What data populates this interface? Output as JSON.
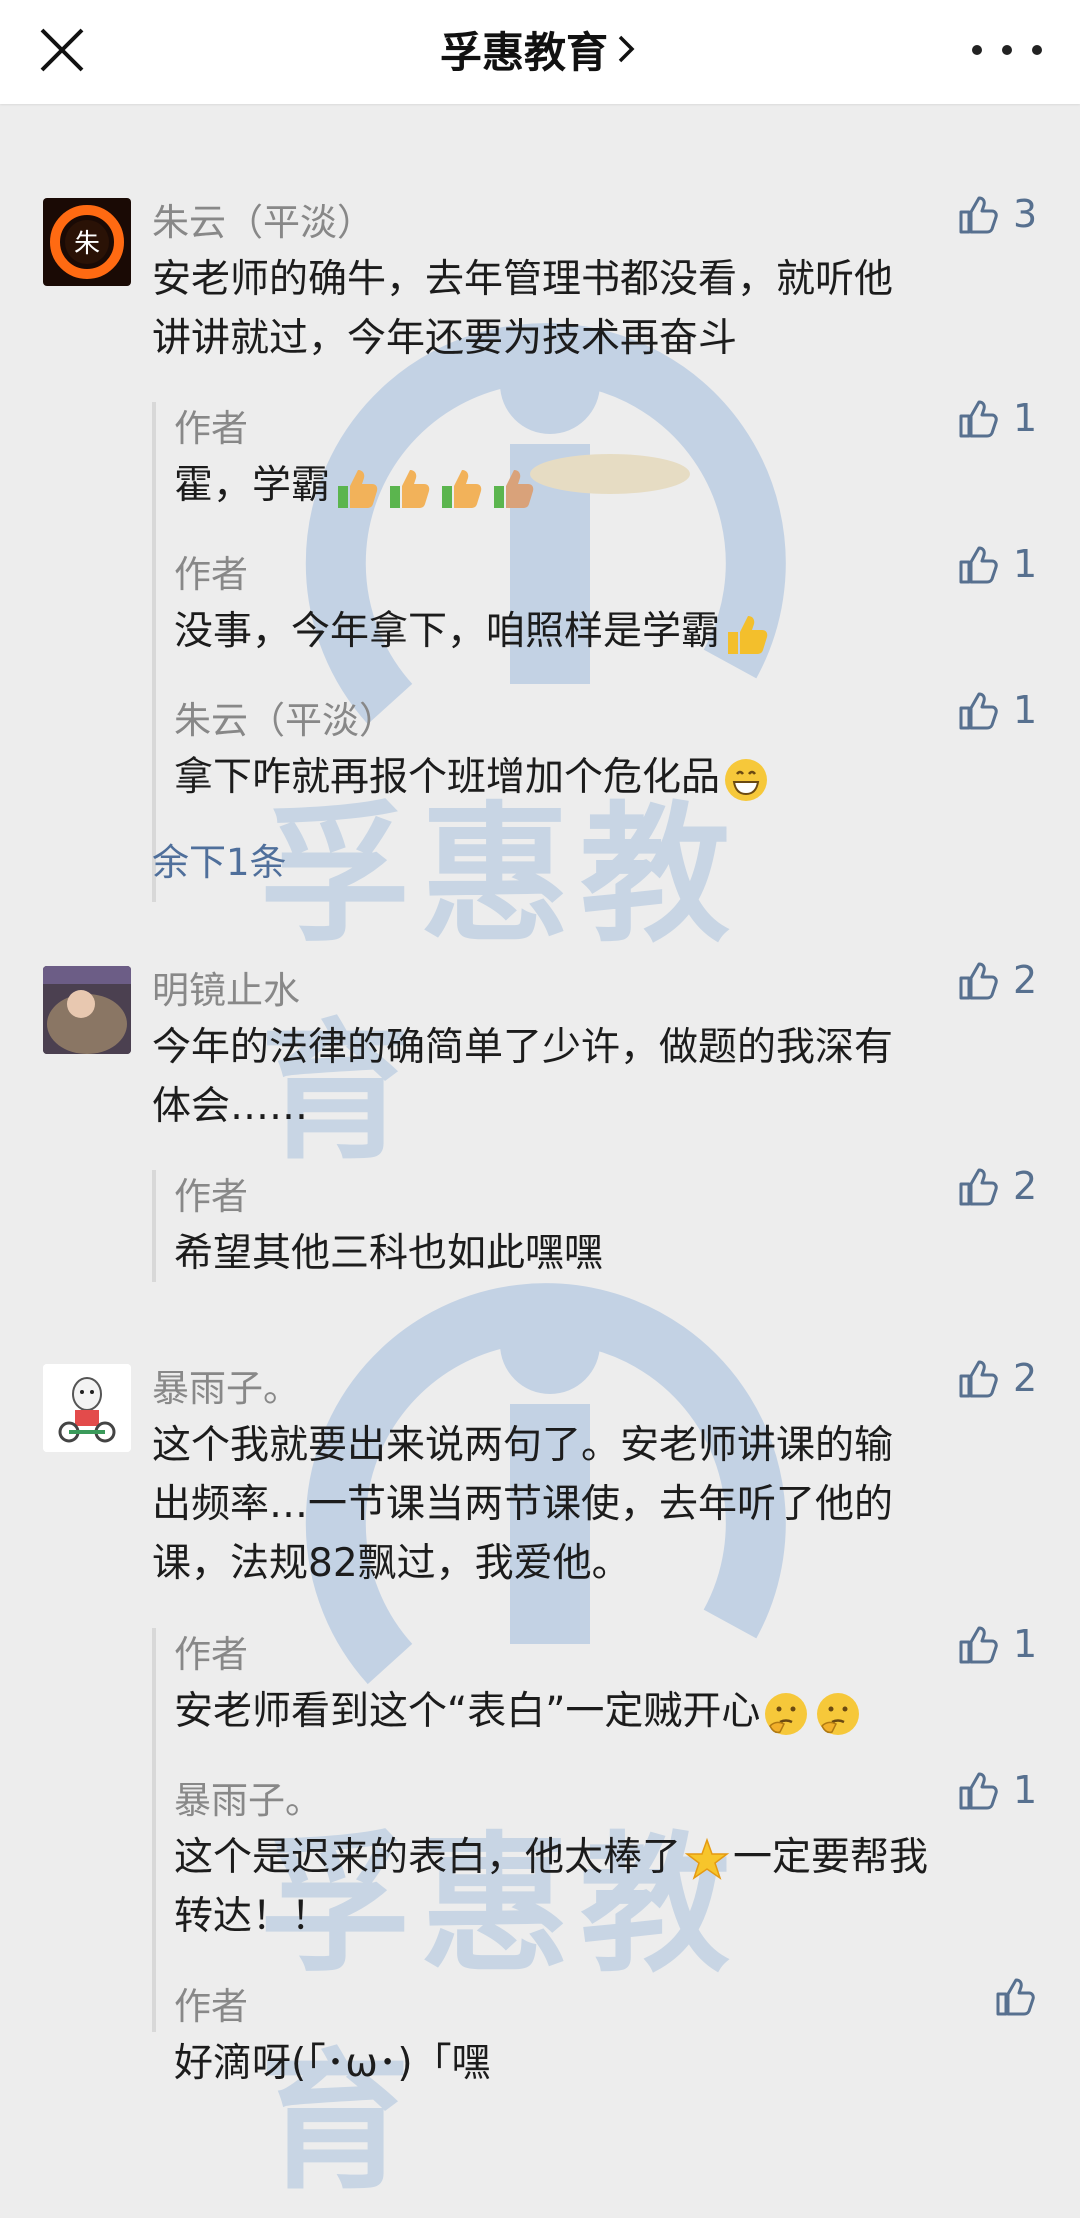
{
  "header": {
    "title": "孚惠教育"
  },
  "watermark_text": "孚惠教育",
  "threads": [
    {
      "name": "朱云（平淡）",
      "likes": "3",
      "text_lines": [
        "安老师的确牛，去年管理书都没看，就听他",
        "讲讲就过，今年还要为技术再奋斗"
      ],
      "replies": [
        {
          "name": "作者",
          "likes": "1",
          "text": "霍，学霸"
        },
        {
          "name": "作者",
          "likes": "1",
          "text": "没事，今年拿下，咱照样是学霸"
        },
        {
          "name": "朱云（平淡）",
          "likes": "1",
          "text": "拿下咋就再报个班增加个危化品"
        }
      ],
      "more": "余下1条"
    },
    {
      "name": "明镜止水",
      "likes": "2",
      "text_lines": [
        "今年的法律的确简单了少许，做题的我深有",
        "体会……"
      ],
      "replies": [
        {
          "name": "作者",
          "likes": "2",
          "text": "希望其他三科也如此嘿嘿"
        }
      ]
    },
    {
      "name": "暴雨子。",
      "likes": "2",
      "text_lines": [
        "这个我就要出来说两句了。安老师讲课的输",
        "出频率…一节课当两节课使，去年听了他的",
        "课，法规82飘过，我爱他。"
      ],
      "replies": [
        {
          "name": "作者",
          "likes": "1",
          "text": "安老师看到这个“表白”一定贼开心"
        },
        {
          "name": "暴雨子。",
          "likes": "1",
          "text_lines": [
            "这个是迟来的表白，他太棒了",
            "转达！！"
          ],
          "text_after_emoji": "一定要帮我"
        },
        {
          "name": "作者",
          "likes": "",
          "text": "好滴呀(「･ω･)「嘿"
        }
      ]
    }
  ]
}
